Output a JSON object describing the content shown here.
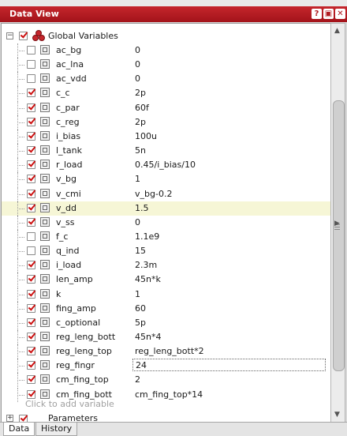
{
  "window": {
    "title": "Data View",
    "buttons": [
      "?",
      "▣",
      "✕"
    ]
  },
  "group": {
    "label": "Global Variables",
    "expander": "−",
    "checked": true
  },
  "variables": [
    {
      "name": "ac_bg",
      "value": "0",
      "checked": false
    },
    {
      "name": "ac_lna",
      "value": "0",
      "checked": false
    },
    {
      "name": "ac_vdd",
      "value": "0",
      "checked": false
    },
    {
      "name": "c_c",
      "value": "2p",
      "checked": true
    },
    {
      "name": "c_par",
      "value": "60f",
      "checked": true
    },
    {
      "name": "c_reg",
      "value": "2p",
      "checked": true
    },
    {
      "name": "i_bias",
      "value": "100u",
      "checked": true
    },
    {
      "name": "l_tank",
      "value": "5n",
      "checked": true
    },
    {
      "name": "r_load",
      "value": "0.45/i_bias/10",
      "checked": true
    },
    {
      "name": "v_bg",
      "value": "1",
      "checked": true
    },
    {
      "name": "v_cmi",
      "value": "v_bg-0.2",
      "checked": true
    },
    {
      "name": "v_dd",
      "value": "1.5",
      "checked": true,
      "selected": true
    },
    {
      "name": "v_ss",
      "value": "0",
      "checked": true
    },
    {
      "name": "f_c",
      "value": "1.1e9",
      "checked": false
    },
    {
      "name": "q_ind",
      "value": "15",
      "checked": false
    },
    {
      "name": "i_load",
      "value": "2.3m",
      "checked": true
    },
    {
      "name": "len_amp",
      "value": "45n*k",
      "checked": true
    },
    {
      "name": "k",
      "value": "1",
      "checked": true
    },
    {
      "name": "fing_amp",
      "value": "60",
      "checked": true
    },
    {
      "name": "c_optional",
      "value": "5p",
      "checked": true
    },
    {
      "name": "reg_leng_bott",
      "value": "45n*4",
      "checked": true
    },
    {
      "name": "reg_leng_top",
      "value": "reg_leng_bott*2",
      "checked": true
    },
    {
      "name": "reg_fingr",
      "value": "24",
      "checked": true,
      "editing": true
    },
    {
      "name": "cm_fing_top",
      "value": "2",
      "checked": true
    },
    {
      "name": "cm_fing_bott",
      "value": "cm_fing_top*14",
      "checked": true
    }
  ],
  "add_hint": "Click to add variable",
  "next_group": "Parameters",
  "tabs": [
    {
      "label": "Data",
      "active": true
    },
    {
      "label": "History",
      "active": false
    }
  ],
  "colors": {
    "title_bar": "#b01a20",
    "check": "#cc1010",
    "selected_row": "#f6f6d6"
  }
}
